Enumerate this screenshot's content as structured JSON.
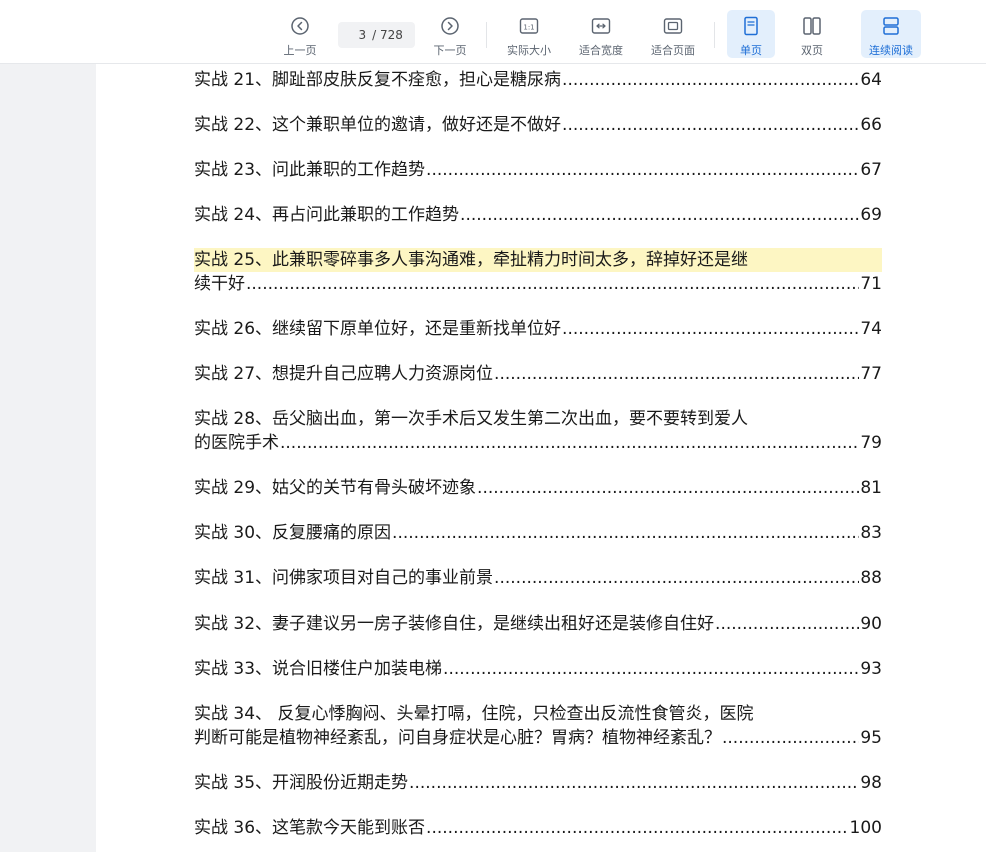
{
  "toolbar": {
    "prev_label": "上一页",
    "next_label": "下一页",
    "current_page": "3",
    "total_pages": "/ 728",
    "actual_size_label": "实际大小",
    "fit_width_label": "适合宽度",
    "fit_page_label": "适合页面",
    "single_page_label": "单页",
    "double_page_label": "双页",
    "continuous_label": "连续阅读",
    "actual_size_icon_text": "1:1",
    "accent_color": "#1f6fd6"
  },
  "toc": [
    {
      "lines": [
        "实战 21、脚趾部皮肤反复不痊愈，担心是糖尿病"
      ],
      "page": "64",
      "highlight": false
    },
    {
      "lines": [
        "实战 22、这个兼职单位的邀请，做好还是不做好"
      ],
      "page": "66",
      "highlight": false
    },
    {
      "lines": [
        "实战 23、问此兼职的工作趋势"
      ],
      "page": "67",
      "highlight": false
    },
    {
      "lines": [
        "实战 24、再占问此兼职的工作趋势"
      ],
      "page": "69",
      "highlight": false
    },
    {
      "lines": [
        "实战 25、此兼职零碎事多人事沟通难，牵扯精力时间太多，辞掉好还是继",
        "续干好"
      ],
      "page": "71",
      "highlight": true
    },
    {
      "lines": [
        "实战 26、继续留下原单位好，还是重新找单位好"
      ],
      "page": "74",
      "highlight": false
    },
    {
      "lines": [
        "实战 27、想提升自己应聘人力资源岗位 "
      ],
      "page": "77",
      "highlight": false
    },
    {
      "lines": [
        "实战 28、岳父脑出血，第一次手术后又发生第二次出血，要不要转到爱人",
        "的医院手术 "
      ],
      "page": "79",
      "highlight": false
    },
    {
      "lines": [
        "实战 29、姑父的关节有骨头破坏迹象"
      ],
      "page": "81",
      "highlight": false
    },
    {
      "lines": [
        "实战 30、反复腰痛的原因"
      ],
      "page": "83",
      "highlight": false
    },
    {
      "lines": [
        "实战 31、问佛家项目对自己的事业前景"
      ],
      "page": "88",
      "highlight": false
    },
    {
      "lines": [
        "实战 32、妻子建议另一房子装修自住，是继续出租好还是装修自住好"
      ],
      "page": "90",
      "highlight": false
    },
    {
      "lines": [
        "实战 33、说合旧楼住户加装电梯"
      ],
      "page": "93",
      "highlight": false
    },
    {
      "lines": [
        "实战 34、 反复心悸胸闷、头晕打嗝，住院，只检查出反流性食管炎，医院",
        "判断可能是植物神经紊乱，问自身症状是心脏？胃病？植物神经紊乱？"
      ],
      "page": "95",
      "highlight": false
    },
    {
      "lines": [
        "实战 35、开润股份近期走势 "
      ],
      "page": "98",
      "highlight": false
    },
    {
      "lines": [
        "实战 36、这笔款今天能到账否"
      ],
      "page": "100",
      "highlight": false
    }
  ]
}
